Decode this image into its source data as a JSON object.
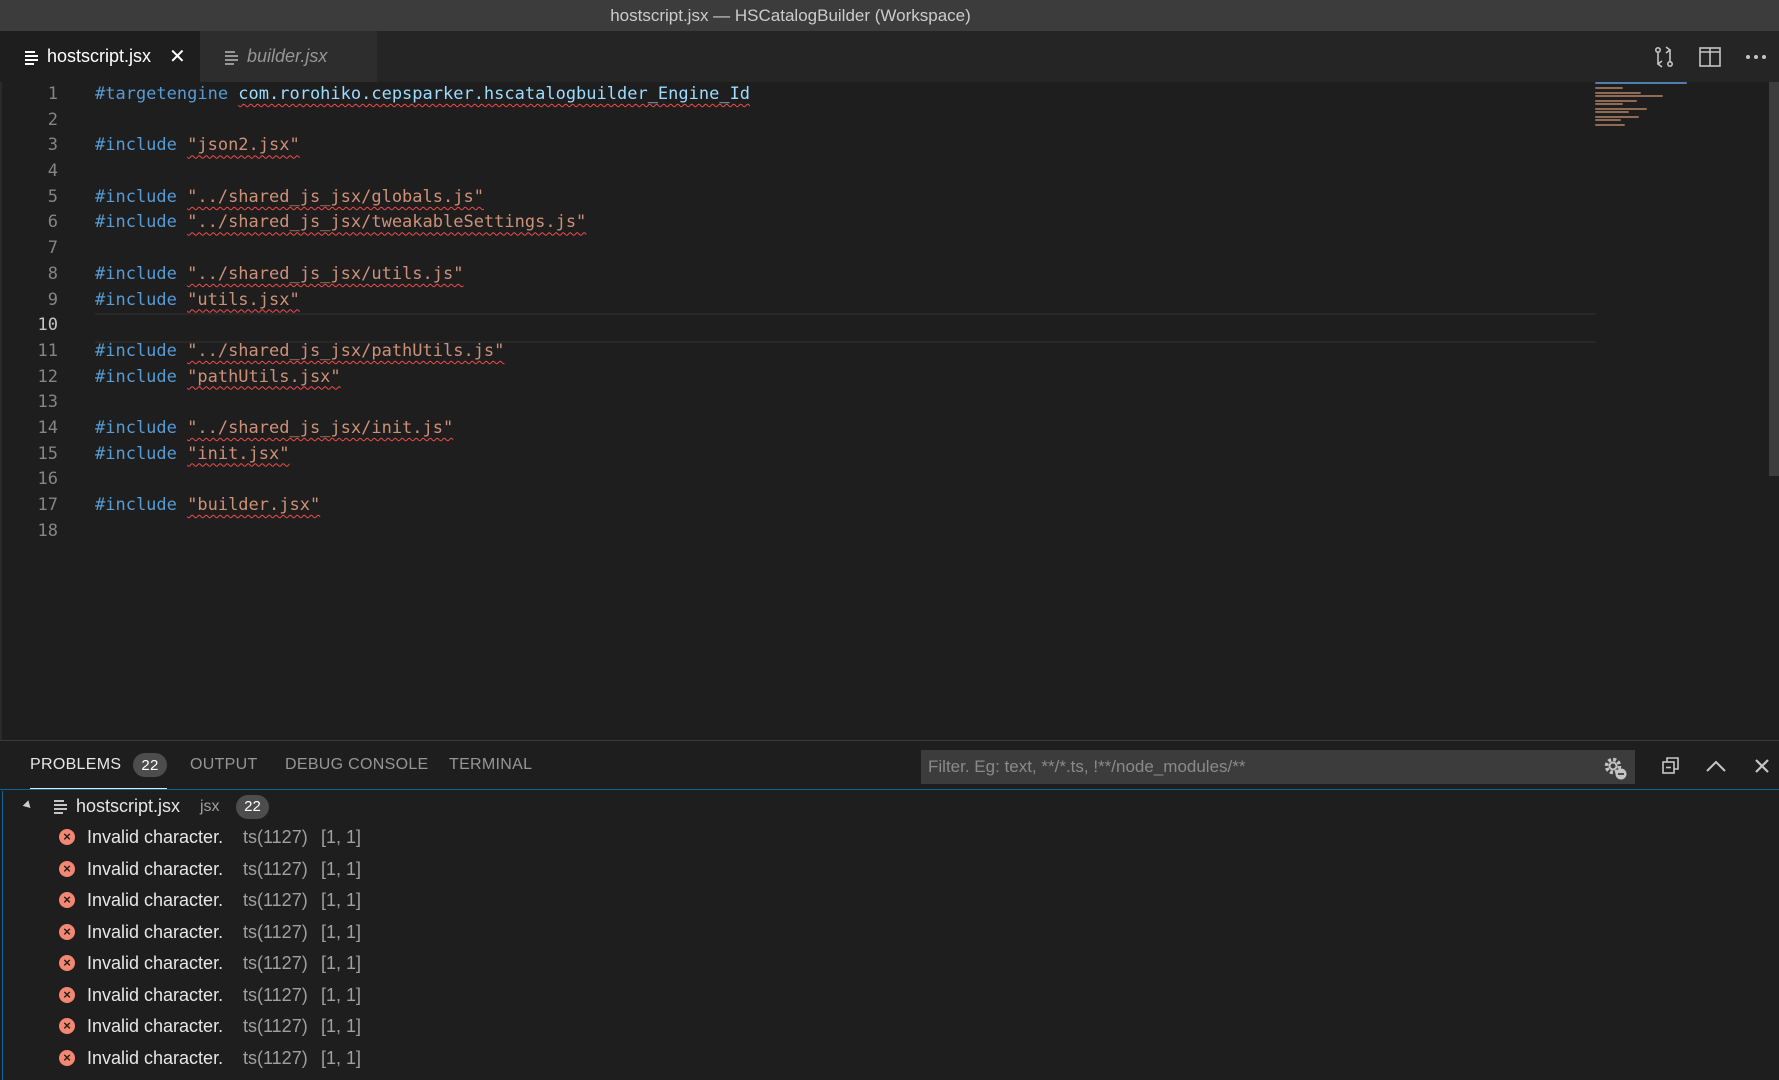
{
  "window": {
    "title": "hostscript.jsx — HSCatalogBuilder (Workspace)"
  },
  "tabs": [
    {
      "label": "hostscript.jsx",
      "active": true,
      "close_glyph": "✕"
    },
    {
      "label": "builder.jsx",
      "active": false
    }
  ],
  "tab_actions": [
    "open-changes-icon",
    "split-editor-icon",
    "more-actions-icon"
  ],
  "editor": {
    "current_line": 10,
    "lines": [
      {
        "n": "1",
        "tokens": [
          {
            "t": "#targetengine ",
            "c": "kw"
          },
          {
            "t": "com.rorohiko.cepsparker.hscatalogbuilder_Engine_Id",
            "c": "id"
          }
        ]
      },
      {
        "n": "2",
        "tokens": []
      },
      {
        "n": "3",
        "tokens": [
          {
            "t": "#include ",
            "c": "kw"
          },
          {
            "t": "\"json2.jsx\"",
            "c": "str"
          }
        ]
      },
      {
        "n": "4",
        "tokens": []
      },
      {
        "n": "5",
        "tokens": [
          {
            "t": "#include ",
            "c": "kw"
          },
          {
            "t": "\"../shared_js_jsx/globals.js\"",
            "c": "str"
          }
        ]
      },
      {
        "n": "6",
        "tokens": [
          {
            "t": "#include ",
            "c": "kw"
          },
          {
            "t": "\"../shared_js_jsx/tweakableSettings.js\"",
            "c": "str"
          }
        ]
      },
      {
        "n": "7",
        "tokens": []
      },
      {
        "n": "8",
        "tokens": [
          {
            "t": "#include ",
            "c": "kw"
          },
          {
            "t": "\"../shared_js_jsx/utils.js\"",
            "c": "str"
          }
        ]
      },
      {
        "n": "9",
        "tokens": [
          {
            "t": "#include ",
            "c": "kw"
          },
          {
            "t": "\"utils.jsx\"",
            "c": "str"
          }
        ]
      },
      {
        "n": "10",
        "tokens": []
      },
      {
        "n": "11",
        "tokens": [
          {
            "t": "#include ",
            "c": "kw"
          },
          {
            "t": "\"../shared_js_jsx/pathUtils.js\"",
            "c": "str"
          }
        ]
      },
      {
        "n": "12",
        "tokens": [
          {
            "t": "#include ",
            "c": "kw"
          },
          {
            "t": "\"pathUtils.jsx\"",
            "c": "str"
          }
        ]
      },
      {
        "n": "13",
        "tokens": []
      },
      {
        "n": "14",
        "tokens": [
          {
            "t": "#include ",
            "c": "kw"
          },
          {
            "t": "\"../shared_js_jsx/init.js\"",
            "c": "str"
          }
        ]
      },
      {
        "n": "15",
        "tokens": [
          {
            "t": "#include ",
            "c": "kw"
          },
          {
            "t": "\"init.jsx\"",
            "c": "str"
          }
        ]
      },
      {
        "n": "16",
        "tokens": []
      },
      {
        "n": "17",
        "tokens": [
          {
            "t": "#include ",
            "c": "kw"
          },
          {
            "t": "\"builder.jsx\"",
            "c": "str"
          }
        ]
      },
      {
        "n": "18",
        "tokens": []
      }
    ]
  },
  "panel": {
    "tabs": [
      {
        "label": "PROBLEMS",
        "badge": "22",
        "active": true
      },
      {
        "label": "OUTPUT"
      },
      {
        "label": "DEBUG CONSOLE"
      },
      {
        "label": "TERMINAL"
      }
    ],
    "filter_placeholder": "Filter. Eg: text, **/*.ts, !**/node_modules/**",
    "file": {
      "name": "hostscript.jsx",
      "ext": "jsx",
      "count": "22"
    },
    "problems": [
      {
        "message": "Invalid character.",
        "source": "ts(1127)",
        "position": "[1, 1]"
      },
      {
        "message": "Invalid character.",
        "source": "ts(1127)",
        "position": "[1, 1]"
      },
      {
        "message": "Invalid character.",
        "source": "ts(1127)",
        "position": "[1, 1]"
      },
      {
        "message": "Invalid character.",
        "source": "ts(1127)",
        "position": "[1, 1]"
      },
      {
        "message": "Invalid character.",
        "source": "ts(1127)",
        "position": "[1, 1]"
      },
      {
        "message": "Invalid character.",
        "source": "ts(1127)",
        "position": "[1, 1]"
      },
      {
        "message": "Invalid character.",
        "source": "ts(1127)",
        "position": "[1, 1]"
      },
      {
        "message": "Invalid character.",
        "source": "ts(1127)",
        "position": "[1, 1]"
      }
    ]
  },
  "colors": {
    "keyword": "#569cd6",
    "string": "#ce9178",
    "identifier": "#9cdcfe",
    "error": "#f48771",
    "squiggle": "#f14c4c",
    "accent": "#0e639c"
  }
}
